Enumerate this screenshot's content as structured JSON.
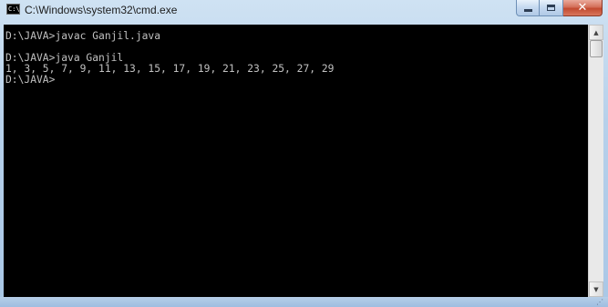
{
  "window": {
    "title": "C:\\Windows\\system32\\cmd.exe",
    "icon": "cmd-icon",
    "icon_label": "C:\\"
  },
  "caption_buttons": {
    "minimize": "minimize-icon",
    "maximize": "maximize-icon",
    "close": "close-icon",
    "close_glyph": "✕"
  },
  "console": {
    "lines": [
      "D:\\JAVA>javac Ganjil.java",
      "",
      "D:\\JAVA>java Ganjil",
      "1, 3, 5, 7, 9, 11, 13, 15, 17, 19, 21, 23, 25, 27, 29",
      "D:\\JAVA>"
    ],
    "background": "#000000",
    "foreground": "#c0c0c0"
  },
  "scrollbar": {
    "up_arrow": "▲",
    "down_arrow": "▼"
  },
  "resize_grip": "⋰"
}
